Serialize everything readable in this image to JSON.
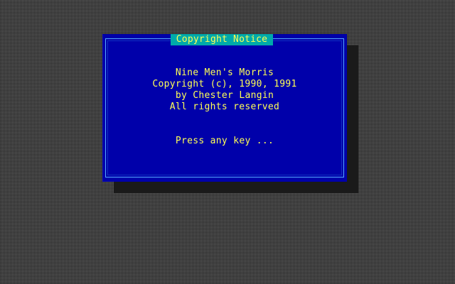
{
  "dialog": {
    "title": "Copyright Notice",
    "lines": [
      "Nine Men's Morris",
      "Copyright (c), 1990, 1991",
      "by Chester Langin",
      "All rights reserved"
    ],
    "prompt": "Press any key ..."
  },
  "colors": {
    "dialog_bg": "#0000aa",
    "title_bg": "#00aaaa",
    "text": "#ffff55",
    "frame": "#55aaff",
    "shadow": "#1a1a1a"
  }
}
